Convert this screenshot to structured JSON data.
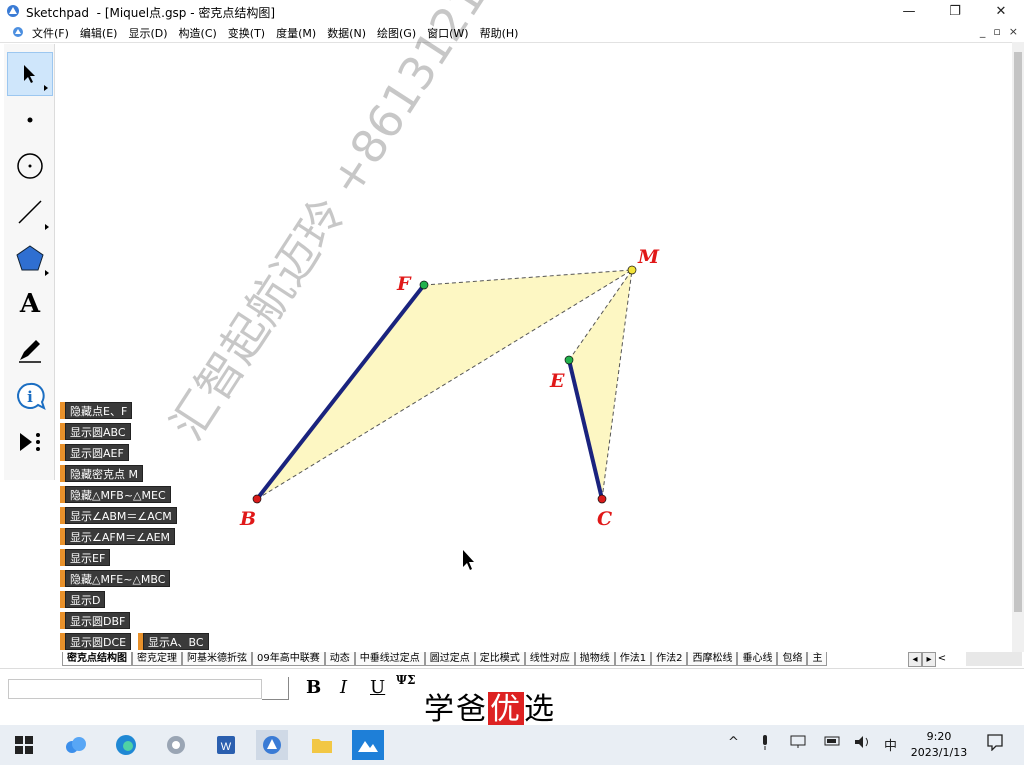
{
  "window": {
    "app": "Sketchpad",
    "doc_title": "- [Miquel点.gsp - 密克点结构图]",
    "minimize": "—",
    "restore": "❐",
    "close": "✕"
  },
  "menu": [
    "文件(F)",
    "编辑(E)",
    "显示(D)",
    "构造(C)",
    "变换(T)",
    "度量(M)",
    "数据(N)",
    "绘图(G)",
    "窗口(W)",
    "帮助(H)"
  ],
  "mdi": {
    "min": "_",
    "restore": "▫",
    "close": "×"
  },
  "tools": [
    "arrow-select-tool",
    "point-tool",
    "compass-tool",
    "straightedge-tool",
    "polygon-tool",
    "text-tool",
    "marker-tool",
    "information-tool",
    "custom-tool"
  ],
  "text_tool_label": "A",
  "figure": {
    "points": {
      "F": "F",
      "M": "M",
      "E": "E",
      "B": "B",
      "C": "C"
    },
    "colors": {
      "segment": "#1a237e",
      "fill": "#fdf7c3",
      "label": "#e01818",
      "point_red": "#d91b1b",
      "point_green": "#22b14c",
      "point_yellow": "#f2e33b"
    }
  },
  "action_buttons": [
    "隐藏点E、F",
    "显示圆ABC",
    "显示圆AEF",
    "隐藏密克点 M",
    "隐藏△MFB~△MEC",
    "显示∠ABM＝∠ACM",
    "显示∠AFM＝∠AEM",
    "显示EF",
    "隐藏△MFE~△MBC",
    "显示D",
    "显示圆DBF",
    "显示圆DCE",
    "显示A、BC"
  ],
  "tabs": [
    "密克点结构图",
    "密克定理",
    "阿基米德折弦",
    "09年高中联赛",
    "动态",
    "中垂线过定点",
    "圆过定点",
    "定比模式",
    "线性对应",
    "抛物线",
    "作法1",
    "作法2",
    "西摩松线",
    "垂心线",
    "包络",
    "主"
  ],
  "tab_nav": [
    "◂",
    "▸",
    "<"
  ],
  "text_format": {
    "bold": "B",
    "italic": "I",
    "underline": "U",
    "symbol": "ΨΣ"
  },
  "watermark": "汇智起航迈玲 +8613121274687",
  "brand": {
    "pre": "学爸",
    "highlight": "优",
    "post": "选"
  },
  "taskbar": {
    "ime": "中",
    "time": "9:20",
    "date": "2023/1/13"
  }
}
